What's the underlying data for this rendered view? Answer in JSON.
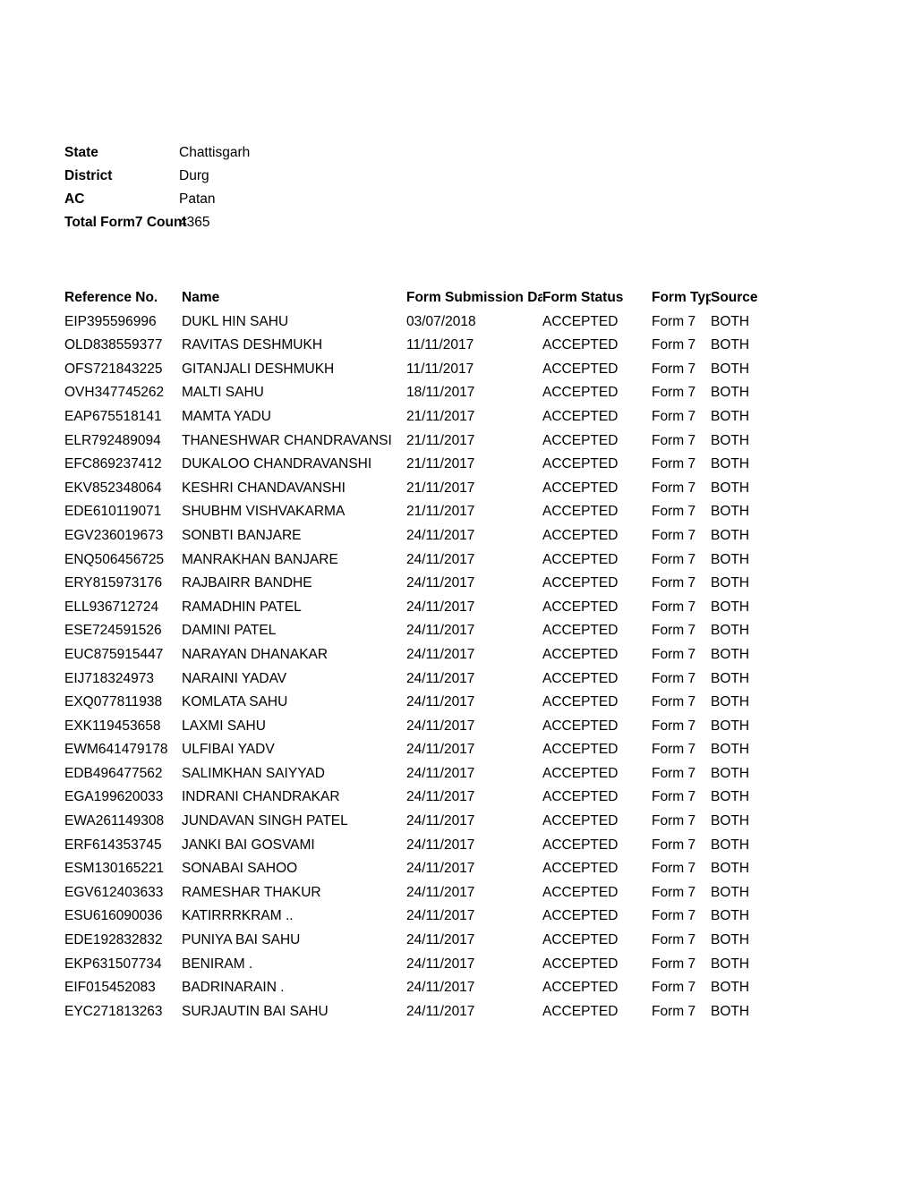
{
  "report": {
    "meta": [
      {
        "label": "State",
        "value": "Chattisgarh"
      },
      {
        "label": "District",
        "value": "Durg"
      },
      {
        "label": "AC",
        "value": "Patan"
      },
      {
        "label": "Total Form7 Count",
        "value": "4365"
      }
    ],
    "columns": {
      "reference_no": "Reference No.",
      "name": "Name",
      "form_submission_date": "Form Submission Date",
      "form_status": "Form Status",
      "form_type": "Form Type",
      "source": "Source"
    },
    "rows": [
      {
        "reference_no": "EIP395596996",
        "name": "DUKL HIN SAHU",
        "form_submission_date": "03/07/2018",
        "form_status": "ACCEPTED",
        "form_type": "Form 7",
        "source": "BOTH"
      },
      {
        "reference_no": "OLD838559377",
        "name": "RAVITAS DESHMUKH",
        "form_submission_date": "11/11/2017",
        "form_status": "ACCEPTED",
        "form_type": "Form 7",
        "source": "BOTH"
      },
      {
        "reference_no": "OFS721843225",
        "name": "GITANJALI DESHMUKH",
        "form_submission_date": "11/11/2017",
        "form_status": "ACCEPTED",
        "form_type": "Form 7",
        "source": "BOTH"
      },
      {
        "reference_no": "OVH347745262",
        "name": "MALTI SAHU",
        "form_submission_date": "18/11/2017",
        "form_status": "ACCEPTED",
        "form_type": "Form 7",
        "source": "BOTH"
      },
      {
        "reference_no": "EAP675518141",
        "name": "MAMTA YADU",
        "form_submission_date": "21/11/2017",
        "form_status": "ACCEPTED",
        "form_type": "Form 7",
        "source": "BOTH"
      },
      {
        "reference_no": "ELR792489094",
        "name": "THANESHWAR CHANDRAVANSI",
        "form_submission_date": "21/11/2017",
        "form_status": "ACCEPTED",
        "form_type": "Form 7",
        "source": "BOTH"
      },
      {
        "reference_no": "EFC869237412",
        "name": "DUKALOO CHANDRAVANSHI",
        "form_submission_date": "21/11/2017",
        "form_status": "ACCEPTED",
        "form_type": "Form 7",
        "source": "BOTH"
      },
      {
        "reference_no": "EKV852348064",
        "name": "KESHRI CHANDAVANSHI",
        "form_submission_date": "21/11/2017",
        "form_status": "ACCEPTED",
        "form_type": "Form 7",
        "source": "BOTH"
      },
      {
        "reference_no": "EDE610119071",
        "name": "SHUBHM VISHVAKARMA",
        "form_submission_date": "21/11/2017",
        "form_status": "ACCEPTED",
        "form_type": "Form 7",
        "source": "BOTH"
      },
      {
        "reference_no": "EGV236019673",
        "name": "SONBTI BANJARE",
        "form_submission_date": "24/11/2017",
        "form_status": "ACCEPTED",
        "form_type": "Form 7",
        "source": "BOTH"
      },
      {
        "reference_no": "ENQ506456725",
        "name": "MANRAKHAN BANJARE",
        "form_submission_date": "24/11/2017",
        "form_status": "ACCEPTED",
        "form_type": "Form 7",
        "source": "BOTH"
      },
      {
        "reference_no": "ERY815973176",
        "name": "RAJBAIRR BANDHE",
        "form_submission_date": "24/11/2017",
        "form_status": "ACCEPTED",
        "form_type": "Form 7",
        "source": "BOTH"
      },
      {
        "reference_no": "ELL936712724",
        "name": "RAMADHIN PATEL",
        "form_submission_date": "24/11/2017",
        "form_status": "ACCEPTED",
        "form_type": "Form 7",
        "source": "BOTH"
      },
      {
        "reference_no": "ESE724591526",
        "name": "DAMINI PATEL",
        "form_submission_date": "24/11/2017",
        "form_status": "ACCEPTED",
        "form_type": "Form 7",
        "source": "BOTH"
      },
      {
        "reference_no": "EUC875915447",
        "name": "NARAYAN DHANAKAR",
        "form_submission_date": "24/11/2017",
        "form_status": "ACCEPTED",
        "form_type": "Form 7",
        "source": "BOTH"
      },
      {
        "reference_no": "EIJ718324973",
        "name": "NARAINI YADAV",
        "form_submission_date": "24/11/2017",
        "form_status": "ACCEPTED",
        "form_type": "Form 7",
        "source": "BOTH"
      },
      {
        "reference_no": "EXQ077811938",
        "name": "KOMLATA SAHU",
        "form_submission_date": "24/11/2017",
        "form_status": "ACCEPTED",
        "form_type": "Form 7",
        "source": "BOTH"
      },
      {
        "reference_no": "EXK119453658",
        "name": "LAXMI SAHU",
        "form_submission_date": "24/11/2017",
        "form_status": "ACCEPTED",
        "form_type": "Form 7",
        "source": "BOTH"
      },
      {
        "reference_no": "EWM641479178",
        "name": "ULFIBAI YADV",
        "form_submission_date": "24/11/2017",
        "form_status": "ACCEPTED",
        "form_type": "Form 7",
        "source": "BOTH"
      },
      {
        "reference_no": "EDB496477562",
        "name": "SALIMKHAN SAIYYAD",
        "form_submission_date": "24/11/2017",
        "form_status": "ACCEPTED",
        "form_type": "Form 7",
        "source": "BOTH"
      },
      {
        "reference_no": "EGA199620033",
        "name": "INDRANI CHANDRAKAR",
        "form_submission_date": "24/11/2017",
        "form_status": "ACCEPTED",
        "form_type": "Form 7",
        "source": "BOTH"
      },
      {
        "reference_no": "EWA261149308",
        "name": "JUNDAVAN SINGH PATEL",
        "form_submission_date": "24/11/2017",
        "form_status": "ACCEPTED",
        "form_type": "Form 7",
        "source": "BOTH"
      },
      {
        "reference_no": "ERF614353745",
        "name": "JANKI BAI GOSVAMI",
        "form_submission_date": "24/11/2017",
        "form_status": "ACCEPTED",
        "form_type": "Form 7",
        "source": "BOTH"
      },
      {
        "reference_no": "ESM130165221",
        "name": "SONABAI SAHOO",
        "form_submission_date": "24/11/2017",
        "form_status": "ACCEPTED",
        "form_type": "Form 7",
        "source": "BOTH"
      },
      {
        "reference_no": "EGV612403633",
        "name": "RAMESHAR THAKUR",
        "form_submission_date": "24/11/2017",
        "form_status": "ACCEPTED",
        "form_type": "Form 7",
        "source": "BOTH"
      },
      {
        "reference_no": "ESU616090036",
        "name": "KATIRRRKRAM ..",
        "form_submission_date": "24/11/2017",
        "form_status": "ACCEPTED",
        "form_type": "Form 7",
        "source": "BOTH"
      },
      {
        "reference_no": "EDE192832832",
        "name": "PUNIYA BAI SAHU",
        "form_submission_date": "24/11/2017",
        "form_status": "ACCEPTED",
        "form_type": "Form 7",
        "source": "BOTH"
      },
      {
        "reference_no": "EKP631507734",
        "name": "BENIRAM .",
        "form_submission_date": "24/11/2017",
        "form_status": "ACCEPTED",
        "form_type": "Form 7",
        "source": "BOTH"
      },
      {
        "reference_no": "EIF015452083",
        "name": "BADRINARAIN .",
        "form_submission_date": "24/11/2017",
        "form_status": "ACCEPTED",
        "form_type": "Form 7",
        "source": "BOTH"
      },
      {
        "reference_no": "EYC271813263",
        "name": "SURJAUTIN BAI SAHU",
        "form_submission_date": "24/11/2017",
        "form_status": "ACCEPTED",
        "form_type": "Form 7",
        "source": "BOTH"
      }
    ]
  }
}
